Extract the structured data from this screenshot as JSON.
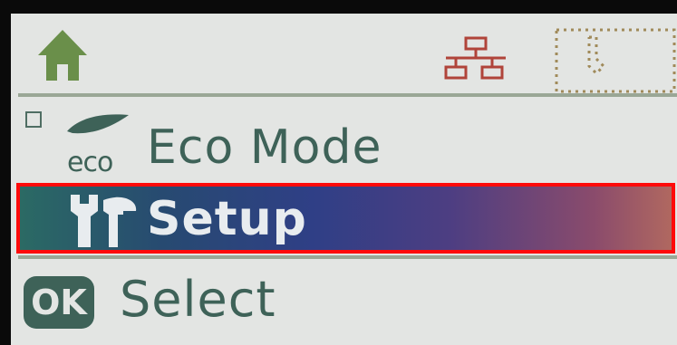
{
  "menu": {
    "eco_small": "eco",
    "eco_label": "Eco Mode",
    "setup_label": "Setup"
  },
  "footer": {
    "ok_label": "OK",
    "select_label": "Select"
  },
  "colors": {
    "icon_green": "#6a8f4a",
    "text_teal": "#3e6258",
    "network_red": "#b0443a",
    "highlight_border": "#ff0a0a",
    "screen_bg": "#e3e5e3"
  },
  "icons": [
    "home-icon",
    "network-icon",
    "memory-card-icon",
    "eco-leaf-icon",
    "wrench-icon",
    "ok-button-icon"
  ]
}
